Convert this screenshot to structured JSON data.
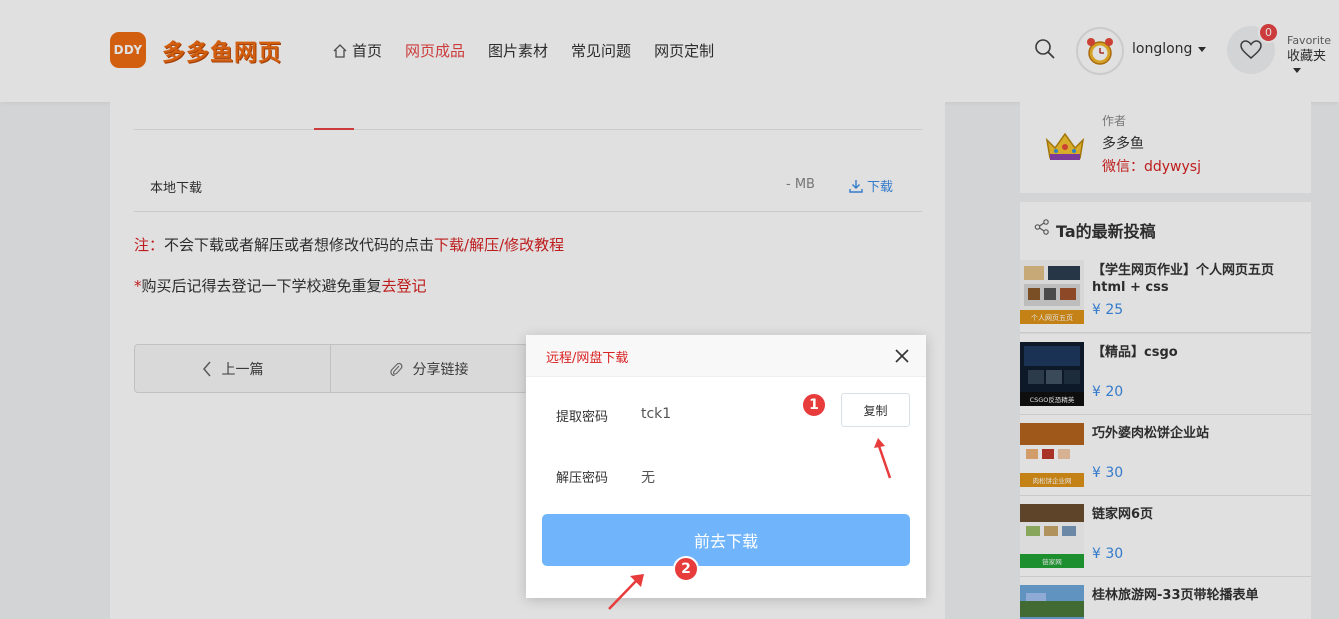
{
  "header": {
    "logo_badge": "DDY",
    "logo_text": "多多鱼网页",
    "nav": [
      {
        "label": "首页",
        "active": false
      },
      {
        "label": "网页成品",
        "active": true
      },
      {
        "label": "图片素材",
        "active": false
      },
      {
        "label": "常见问题",
        "active": false
      },
      {
        "label": "网页定制",
        "active": false
      }
    ],
    "username": "longlong",
    "favorite_count": "0",
    "favorite_en": "Favorite",
    "favorite_cn": "收藏夹"
  },
  "main": {
    "download": {
      "label": "本地下载",
      "size": "- MB",
      "button": "下载"
    },
    "note1": {
      "prefix": "注：",
      "text": "不会下载或者解压或者想修改代码的点击",
      "link": "下载/解压/修改教程"
    },
    "note2": {
      "prefix": "*",
      "text": "购买后记得去登记一下学校避免重复",
      "link": "去登记"
    },
    "pager": {
      "prev": "上一篇",
      "share": "分享链接"
    }
  },
  "sidebar": {
    "author": {
      "role": "作者",
      "name": "多多鱼",
      "wechat": "微信：ddywysj"
    },
    "posts_title": "Ta的最新投稿",
    "posts": [
      {
        "title": "【学生网页作业】个人网页五页 html + css",
        "price": "¥ 25",
        "thumb_caption": "个人网页五页"
      },
      {
        "title": "【精品】csgo",
        "price": "¥ 20",
        "thumb_caption": "CSGO反恐精英"
      },
      {
        "title": "巧外婆肉松饼企业站",
        "price": "¥ 30",
        "thumb_caption": "肉松饼企业网"
      },
      {
        "title": "链家网6页",
        "price": "¥ 30",
        "thumb_caption": "链家网"
      },
      {
        "title": "桂林旅游网-33页带轮播表单",
        "price": "",
        "thumb_caption": ""
      }
    ]
  },
  "modal": {
    "title": "远程/网盘下载",
    "fields": [
      {
        "label": "提取密码",
        "value": "tck1"
      },
      {
        "label": "解压密码",
        "value": "无"
      }
    ],
    "copy_button": "复制",
    "go_button": "前去下载",
    "step1": "1",
    "step2": "2"
  },
  "colors": {
    "accent": "#e94545",
    "brand": "#ef6c12",
    "link": "#3c8ce7",
    "primary_button": "#70b5fb"
  }
}
